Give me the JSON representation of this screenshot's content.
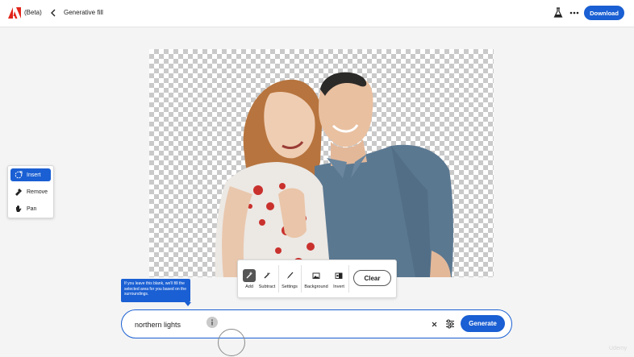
{
  "header": {
    "app_badge": "(Beta)",
    "back_icon": "chevron-left-icon",
    "title": "Generative fill",
    "lab_icon": "flask-icon",
    "more_icon": "more-horizontal-icon",
    "download_label": "Download",
    "brand_color": "#e1251b",
    "accent_color": "#1a5fd3"
  },
  "tools": [
    {
      "icon": "insert-icon",
      "label": "Insert",
      "active": true
    },
    {
      "icon": "remove-icon",
      "label": "Remove",
      "active": false
    },
    {
      "icon": "pan-hand-icon",
      "label": "Pan",
      "active": false
    }
  ],
  "selection_toolbar": {
    "items": [
      {
        "icon": "add-brush-icon",
        "label": "Add",
        "active": true
      },
      {
        "icon": "subtract-brush-icon",
        "label": "Subtract",
        "active": false
      },
      {
        "icon": "brush-settings-icon",
        "label": "Settings",
        "active": false
      },
      {
        "icon": "background-image-icon",
        "label": "Background",
        "active": false
      },
      {
        "icon": "invert-selection-icon",
        "label": "Invert",
        "active": false
      }
    ],
    "clear_label": "Clear"
  },
  "tooltip": {
    "text": "If you leave this blank, we'll fill the selected area for you based on the surroundings."
  },
  "prompt": {
    "value": "northern lights",
    "info_icon": "info-icon",
    "clear_icon": "close-icon",
    "settings_icon": "sliders-icon",
    "generate_label": "Generate"
  },
  "watermark": "Udemy"
}
